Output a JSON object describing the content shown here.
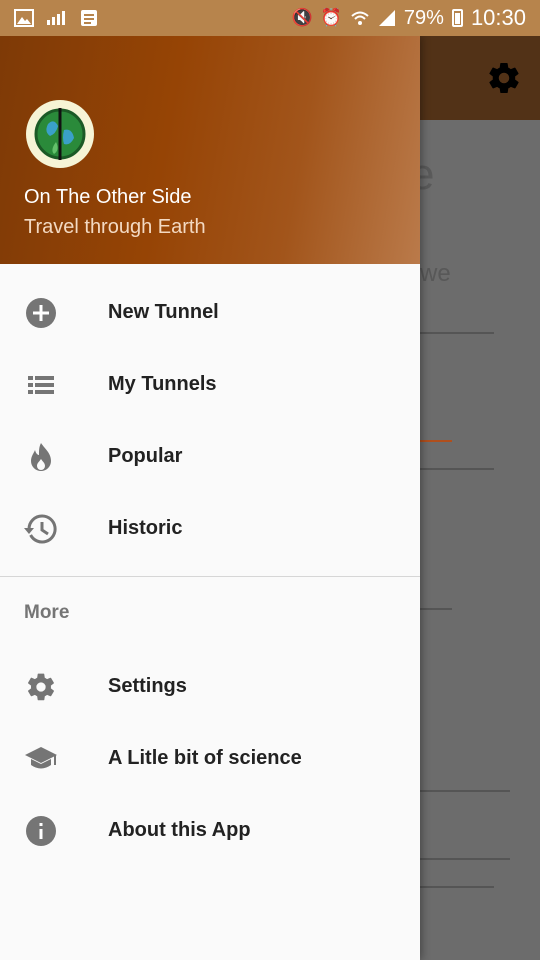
{
  "status_bar": {
    "battery": "79%",
    "time": "10:30"
  },
  "header": {
    "app_name": "On The Other Side",
    "tagline": "Travel through Earth"
  },
  "background": {
    "title_fragment": "e",
    "text_fragment": "we"
  },
  "menu": {
    "items": [
      {
        "label": "New Tunnel",
        "icon": "add-circle-icon"
      },
      {
        "label": "My Tunnels",
        "icon": "list-icon"
      },
      {
        "label": "Popular",
        "icon": "flame-icon"
      },
      {
        "label": "Historic",
        "icon": "history-icon"
      }
    ],
    "more_title": "More",
    "more_items": [
      {
        "label": "Settings",
        "icon": "gear-icon"
      },
      {
        "label": "A Litle bit of science",
        "icon": "school-icon"
      },
      {
        "label": "About this App",
        "icon": "info-icon"
      }
    ]
  },
  "colors": {
    "status_bar": "#b7844c",
    "header_start": "#7e3a06",
    "header_end": "#ba7a4a",
    "icon_grey": "#757575",
    "accent_line": "#c0571f"
  }
}
